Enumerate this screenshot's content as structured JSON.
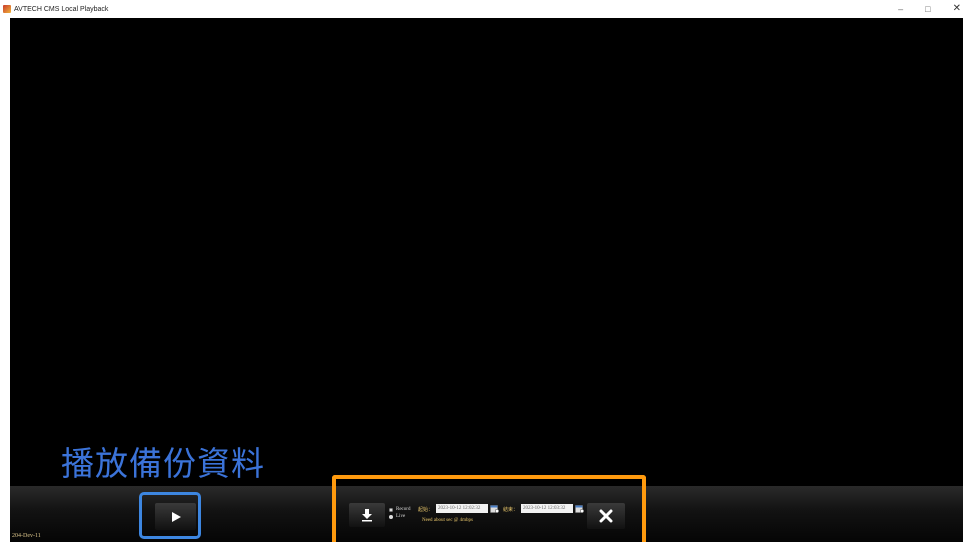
{
  "window": {
    "title": "AVTECH CMS Local Playback",
    "minimize_glyph": "–",
    "maximize_glyph": "□",
    "close_glyph": "✕"
  },
  "video": {
    "caption": "播放備份資料",
    "datestamp": "204-Dev-11"
  },
  "controls": {
    "play_icon": "play-icon",
    "export": {
      "download_icon": "download-icon",
      "radio_record_label": "Record",
      "radio_live_label": "Live",
      "selected_mode": "Record",
      "start_label": "起始：",
      "start_value": "2023-10-12 12:02:32",
      "end_label": "結束：",
      "end_value": "2023-10-12 12:03:32",
      "need_text": "Need about sec @ 4mbps",
      "close_icon": "close-x-icon"
    }
  },
  "colors": {
    "caption": "#3b73d9",
    "play_highlight": "#3d86e0",
    "export_highlight": "#ff9a0e",
    "label_gold": "#e6c46a"
  }
}
